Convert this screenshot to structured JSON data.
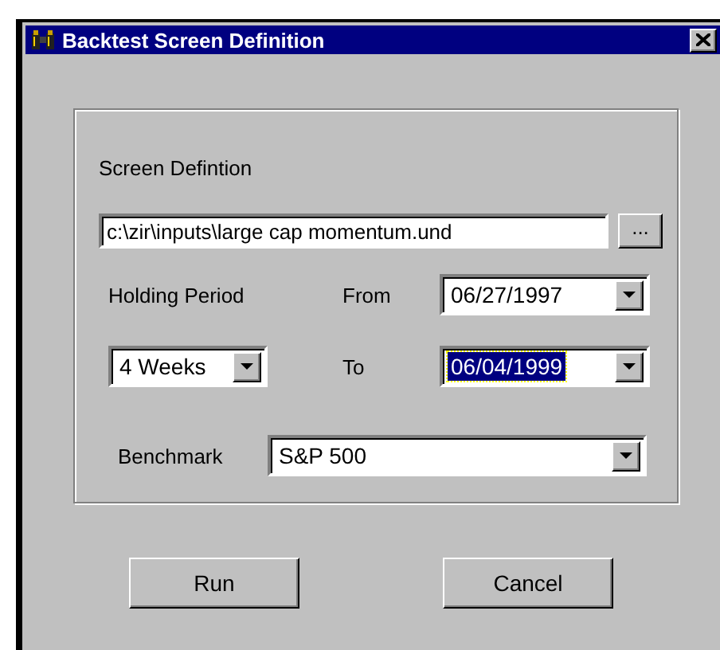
{
  "window": {
    "title": "Backtest Screen Definition"
  },
  "screen_definition": {
    "label": "Screen Defintion",
    "value": "c:\\zir\\inputs\\large cap momentum.und",
    "browse_button": "..."
  },
  "holding_period": {
    "label": "Holding Period",
    "value": "4 Weeks"
  },
  "from": {
    "label": "From",
    "value": "06/27/1997",
    "selected": false
  },
  "to": {
    "label": "To",
    "value": "06/04/1999",
    "selected": true
  },
  "benchmark": {
    "label": "Benchmark",
    "value": "S&P 500"
  },
  "buttons": [
    "Run",
    "Cancel"
  ]
}
